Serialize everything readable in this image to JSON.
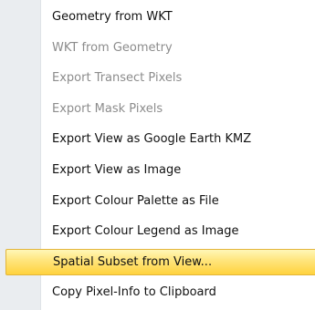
{
  "menu": {
    "items": [
      {
        "label": "Geometry from WKT",
        "enabled": true
      },
      {
        "label": "WKT from Geometry",
        "enabled": false
      },
      {
        "label": "Export Transect Pixels",
        "enabled": false
      },
      {
        "label": "Export Mask Pixels",
        "enabled": false
      },
      {
        "label": "Export View as Google Earth KMZ",
        "enabled": true
      },
      {
        "label": "Export View as Image",
        "enabled": true
      },
      {
        "label": "Export Colour Palette as File",
        "enabled": true
      },
      {
        "label": "Export Colour Legend as Image",
        "enabled": true
      },
      {
        "label": "Spatial Subset from View...",
        "enabled": true,
        "highlighted": true
      },
      {
        "label": "Copy Pixel-Info to Clipboard",
        "enabled": true
      }
    ],
    "highlight_color": "#ffe680",
    "gutter_color": "#eaedf0"
  }
}
